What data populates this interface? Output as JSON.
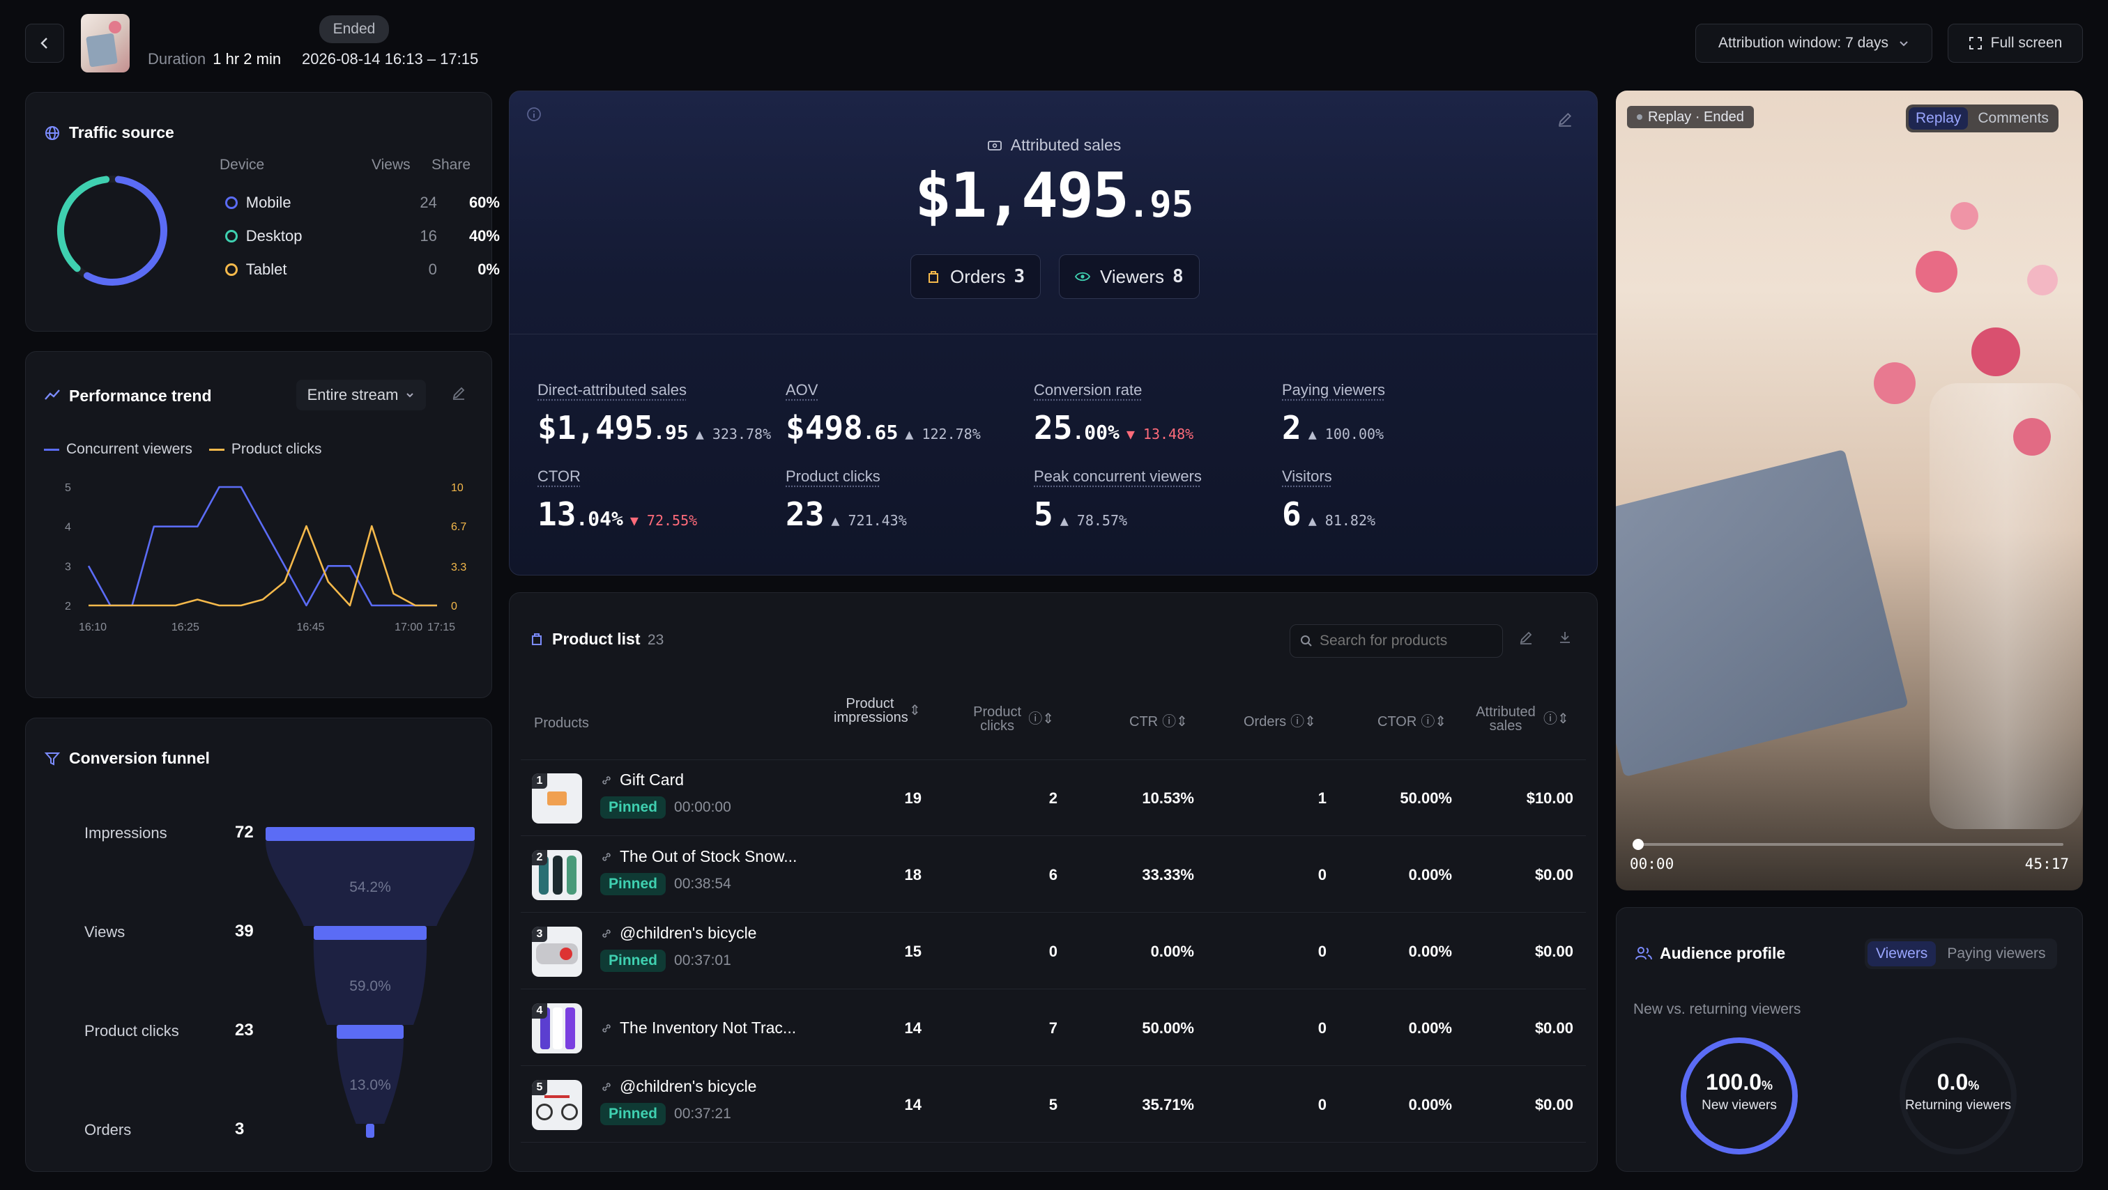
{
  "header": {
    "status_badge": "Ended",
    "duration_label": "Duration",
    "duration_value": "1 hr 2 min",
    "datetime": "2026-08-14 16:13 – 17:15",
    "attribution_label": "Attribution window: 7 days",
    "fullscreen_label": "Full screen"
  },
  "traffic": {
    "title": "Traffic source",
    "col_device": "Device",
    "col_views": "Views",
    "col_share": "Share",
    "rows": [
      {
        "device": "Mobile",
        "views": "24",
        "share": "60%",
        "color": "#5b6cf5",
        "fraction": 0.6
      },
      {
        "device": "Desktop",
        "views": "16",
        "share": "40%",
        "color": "#3fd0b0",
        "fraction": 0.4
      },
      {
        "device": "Tablet",
        "views": "0",
        "share": "0%",
        "color": "#f5b94b",
        "fraction": 0.0
      }
    ]
  },
  "trend": {
    "title": "Performance trend",
    "range": "Entire stream",
    "legend": [
      "Concurrent viewers",
      "Product clicks"
    ]
  },
  "chart_data": {
    "type": "line",
    "x": [
      "16:10",
      "16:13",
      "16:19",
      "16:25",
      "16:31",
      "16:37",
      "16:40",
      "16:43",
      "16:49",
      "16:55",
      "16:58",
      "17:01",
      "17:04",
      "17:07",
      "17:10",
      "17:13",
      "17:16"
    ],
    "x_ticks": [
      "16:10",
      "16:25",
      "16:45",
      "17:00",
      "17:15"
    ],
    "series": [
      {
        "name": "Concurrent viewers",
        "axis": "left",
        "color": "#5b6cf5",
        "values": [
          3,
          2,
          2,
          4,
          4,
          4,
          5,
          5,
          4,
          3,
          2,
          3,
          3,
          2,
          2,
          2,
          2
        ]
      },
      {
        "name": "Product clicks",
        "axis": "right",
        "color": "#f5b94b",
        "values": [
          0,
          0,
          0,
          0,
          0,
          0.5,
          0,
          0,
          0.5,
          2,
          6.7,
          2,
          0,
          6.7,
          1,
          0,
          0
        ]
      }
    ],
    "y_left": {
      "ticks": [
        "2",
        "3",
        "4",
        "5"
      ],
      "range": [
        2,
        5
      ]
    },
    "y_right": {
      "ticks": [
        "0",
        "3.3",
        "6.7",
        "10"
      ],
      "range": [
        0,
        10
      ]
    }
  },
  "funnel": {
    "title": "Conversion funnel",
    "steps": [
      {
        "label": "Impressions",
        "value": "72",
        "fraction": 1.0
      },
      {
        "label": "Views",
        "value": "39",
        "fraction": 0.542
      },
      {
        "label": "Product clicks",
        "value": "23",
        "fraction": 0.32
      },
      {
        "label": "Orders",
        "value": "3",
        "fraction": 0.042
      }
    ],
    "rates": [
      "54.2%",
      "59.0%",
      "13.0%"
    ]
  },
  "hero": {
    "label": "Attributed sales",
    "amount_int": "$1,495",
    "amount_dec": ".95",
    "orders_label": "Orders",
    "orders_value": "3",
    "viewers_label": "Viewers",
    "viewers_value": "8"
  },
  "metrics": [
    {
      "label": "Direct-attributed sales",
      "int": "$1,495",
      "dec": ".95",
      "change": "▲ 323.78%",
      "dir": "up"
    },
    {
      "label": "AOV",
      "int": "$498",
      "dec": ".65",
      "change": "▲ 122.78%",
      "dir": "up"
    },
    {
      "label": "Conversion rate",
      "int": "25",
      "dec": ".00%",
      "change": "▼ 13.48%",
      "dir": "down"
    },
    {
      "label": "Paying viewers",
      "int": "2",
      "dec": "",
      "change": "▲ 100.00%",
      "dir": "up"
    },
    {
      "label": "CTOR",
      "int": "13",
      "dec": ".04%",
      "change": "▼ 72.55%",
      "dir": "down"
    },
    {
      "label": "Product clicks",
      "int": "23",
      "dec": "",
      "change": "▲ 721.43%",
      "dir": "up"
    },
    {
      "label": "Peak concurrent viewers",
      "int": "5",
      "dec": "",
      "change": "▲ 78.57%",
      "dir": "up"
    },
    {
      "label": "Visitors",
      "int": "6",
      "dec": "",
      "change": "▲ 81.82%",
      "dir": "up"
    }
  ],
  "products": {
    "title": "Product list",
    "count": "23",
    "search_placeholder": "Search for products",
    "columns": {
      "products": "Products",
      "impressions": "Product impressions",
      "clicks": "Product clicks",
      "ctr": "CTR",
      "orders": "Orders",
      "ctor": "CTOR",
      "sales": "Attributed sales"
    },
    "pinned_label": "Pinned",
    "rows": [
      {
        "rank": "1",
        "name": "Gift Card",
        "pinned": true,
        "time": "00:00:00",
        "impressions": "19",
        "clicks": "2",
        "ctr": "10.53%",
        "orders": "1",
        "ctor": "50.00%",
        "sales": "$10.00"
      },
      {
        "rank": "2",
        "name": "The Out of Stock Snow...",
        "pinned": true,
        "time": "00:38:54",
        "impressions": "18",
        "clicks": "6",
        "ctr": "33.33%",
        "orders": "0",
        "ctor": "0.00%",
        "sales": "$0.00"
      },
      {
        "rank": "3",
        "name": "@children's bicycle",
        "pinned": true,
        "time": "00:37:01",
        "impressions": "15",
        "clicks": "0",
        "ctr": "0.00%",
        "orders": "0",
        "ctor": "0.00%",
        "sales": "$0.00"
      },
      {
        "rank": "4",
        "name": "The Inventory Not Trac...",
        "pinned": false,
        "time": "",
        "impressions": "14",
        "clicks": "7",
        "ctr": "50.00%",
        "orders": "0",
        "ctor": "0.00%",
        "sales": "$0.00"
      },
      {
        "rank": "5",
        "name": "@children's bicycle",
        "pinned": true,
        "time": "00:37:21",
        "impressions": "14",
        "clicks": "5",
        "ctr": "35.71%",
        "orders": "0",
        "ctor": "0.00%",
        "sales": "$0.00"
      }
    ]
  },
  "video": {
    "status": "Replay · Ended",
    "tabs": [
      "Replay",
      "Comments"
    ],
    "time_current": "00:00",
    "time_total": "45:17",
    "progress": 0.0
  },
  "audience": {
    "title": "Audience profile",
    "tabs": [
      "Viewers",
      "Paying viewers"
    ],
    "subtitle": "New vs. returning viewers",
    "new_value": "100.0",
    "new_unit": "%",
    "new_label": "New viewers",
    "new_fraction": 1.0,
    "ret_value": "0.0",
    "ret_unit": "%",
    "ret_label": "Returning viewers",
    "ret_fraction": 0.0
  }
}
